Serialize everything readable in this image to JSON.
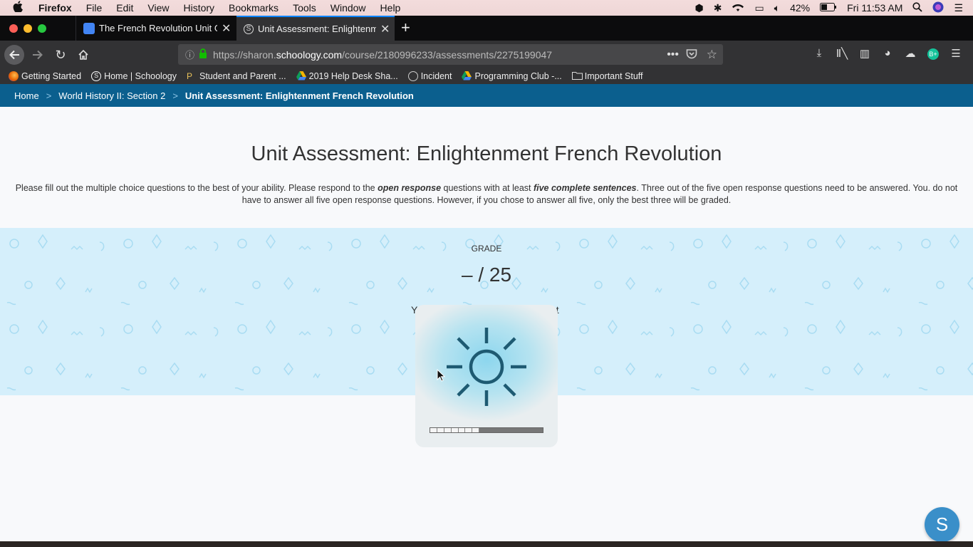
{
  "menubar": {
    "app": "Firefox",
    "items": [
      "File",
      "Edit",
      "View",
      "History",
      "Bookmarks",
      "Tools",
      "Window",
      "Help"
    ],
    "battery": "42%",
    "clock": "Fri 11:53 AM"
  },
  "tabs": [
    {
      "title": "The French Revolution Unit Gui"
    },
    {
      "title": "Unit Assessment: Enlightenmen"
    }
  ],
  "url": {
    "prefix": "https://sharon.",
    "host": "schoology.com",
    "path": "/course/2180996233/assessments/2275199047"
  },
  "bookmarks": [
    {
      "label": "Getting Started",
      "icon": "firefox-icon",
      "color": "#e66000"
    },
    {
      "label": "Home | Schoology",
      "icon": "schoology-icon",
      "color": "#ffffff"
    },
    {
      "label": "Student and Parent ...",
      "icon": "powerschool-icon",
      "color": "#e8c15a"
    },
    {
      "label": "2019 Help Desk Sha...",
      "icon": "drive-icon",
      "color": "#f4b400"
    },
    {
      "label": "Incident",
      "icon": "globe-icon",
      "color": "#cccccc"
    },
    {
      "label": "Programming Club -...",
      "icon": "drive-icon",
      "color": "#f4b400"
    },
    {
      "label": "Important Stuff",
      "icon": "folder-icon",
      "color": "#dddddd"
    }
  ],
  "breadcrumb": {
    "home": "Home",
    "course": "World History II: Section 2",
    "current": "Unit Assessment: Enlightenment French Revolution"
  },
  "page": {
    "title": "Unit Assessment: Enlightenment French Revolution",
    "instructions": {
      "p1": "Please fill out the multiple choice questions to the best of your ability. Please respond to the ",
      "em1": "open response",
      "p2": " questions with at least ",
      "em2": "five complete sentences",
      "p3": ". Three out of the five open response questions need to be answered. You. do not have to answer all five open response questions. However, if you chose to answer all five, only the best three will be graded."
    }
  },
  "grade": {
    "label": "GRADE",
    "value": "– / 25",
    "note_left": "Yo",
    "note_right": "ot"
  },
  "hud": {
    "type": "brightness",
    "level": 0.44
  },
  "chat": {
    "label": "S"
  },
  "colors": {
    "accent": "#0a84ff",
    "breadcrumb_bg": "#0b5f8e",
    "grade_bg": "#d5effb",
    "chat": "#3a8fc9"
  }
}
